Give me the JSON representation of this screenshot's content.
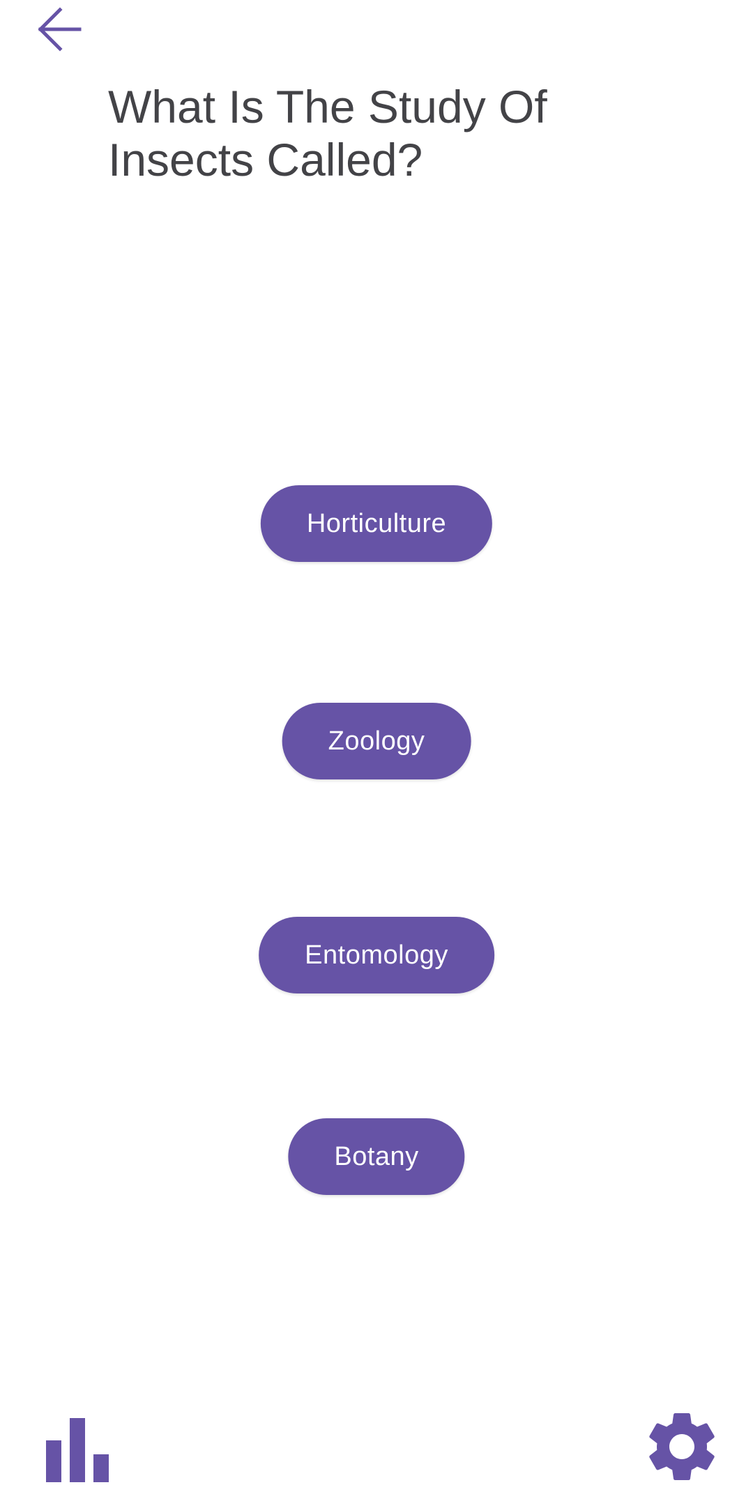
{
  "header": {
    "back_icon": "arrow-left-icon"
  },
  "question": {
    "text": "What Is The Study Of Insects Called?"
  },
  "answers": [
    {
      "label": "Horticulture"
    },
    {
      "label": "Zoology"
    },
    {
      "label": "Entomology"
    },
    {
      "label": "Botany"
    }
  ],
  "footer": {
    "stats_icon": "bar-chart-icon",
    "settings_icon": "gear-icon"
  },
  "colors": {
    "accent": "#6653a6",
    "text": "#434347",
    "background": "#ffffff"
  }
}
